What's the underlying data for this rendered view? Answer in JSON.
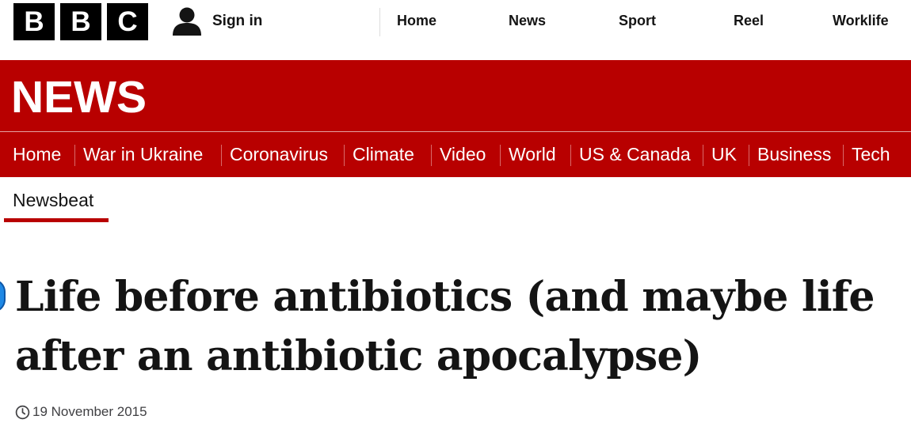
{
  "topbar": {
    "logo_letters": [
      "B",
      "B",
      "C"
    ],
    "signin_label": "Sign in",
    "nav": [
      "Home",
      "News",
      "Sport",
      "Reel",
      "Worklife"
    ]
  },
  "banner": {
    "wordmark": "NEWS",
    "color": "#b80000"
  },
  "sections": [
    "Home",
    "War in Ukraine",
    "Coronavirus",
    "Climate",
    "Video",
    "World",
    "US & Canada",
    "UK",
    "Business",
    "Tech"
  ],
  "subnav": {
    "active": "Newsbeat"
  },
  "article": {
    "headline": "Life before antibiotics (and maybe life after an antibiotic apocalypse)",
    "date": "19 November 2015"
  },
  "icons": {
    "user": "user-icon",
    "clock": "clock-icon"
  }
}
